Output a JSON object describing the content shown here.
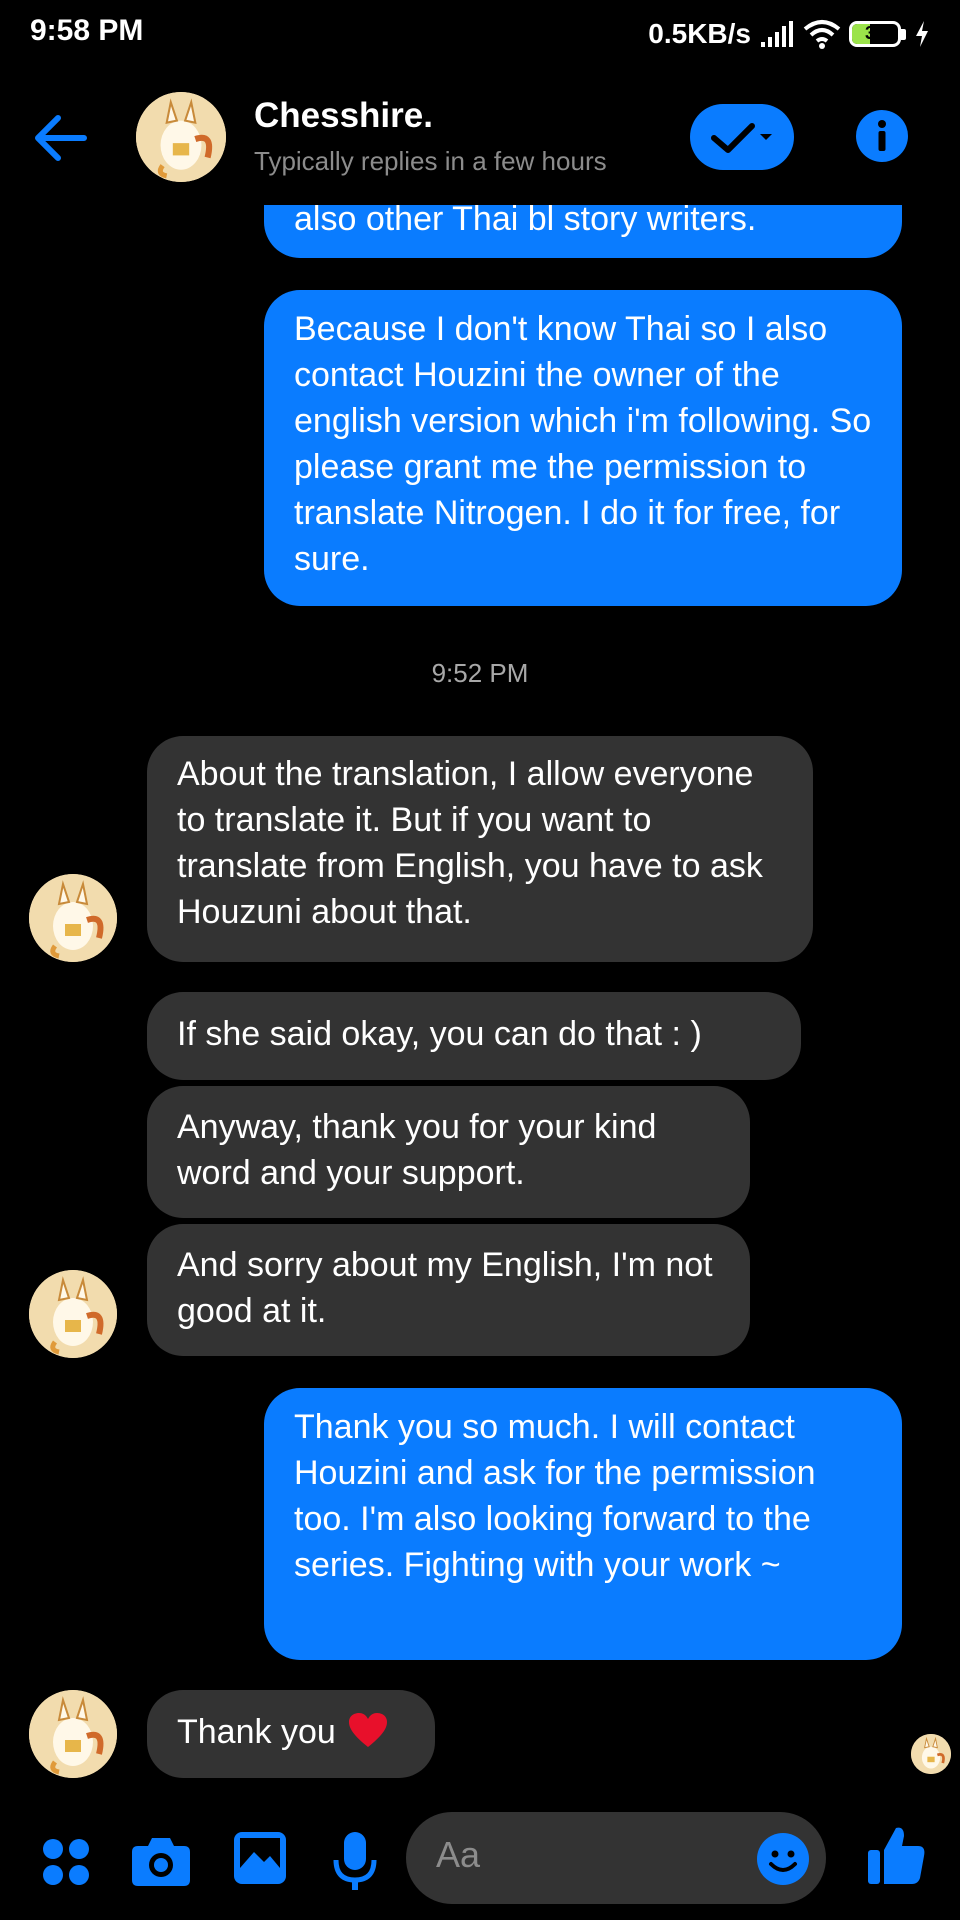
{
  "status_bar": {
    "time": "9:58 PM",
    "network_speed": "0.5KB/s",
    "battery": "39",
    "battery_level": 0.39,
    "icons": [
      "signal-icon",
      "wifi-icon",
      "battery-icon",
      "charging-icon"
    ]
  },
  "header": {
    "contact_name": "Chesshire.",
    "subtitle": "Typically replies in a few hours",
    "icons": [
      "back-arrow-icon",
      "checkmark-icon",
      "chevron-down-icon",
      "info-icon"
    ]
  },
  "messages": [
    {
      "from": "me",
      "text": "also other Thai bl story writers."
    },
    {
      "from": "me",
      "text": "Because I don't know Thai so I also contact Houzini the owner of the english version which i'm following. So please grant me the permission to translate Nitrogen. I do it for free, for sure."
    },
    {
      "from": "them",
      "text": "About the translation, I allow everyone to translate it. But if you want to translate from English, you have to ask Houzuni about that."
    },
    {
      "from": "them",
      "text": "If she said okay, you can do that : )"
    },
    {
      "from": "them",
      "text": "Anyway, thank you for your kind word and your support."
    },
    {
      "from": "them",
      "text": "And sorry about my English, I'm not good at it."
    },
    {
      "from": "me",
      "text": "Thank you so much. I will contact Houzini and ask for the permission too. I'm also looking forward to the series. Fighting with your work ~"
    },
    {
      "from": "them",
      "text": "Thank you",
      "emoji": "heart-emoji"
    }
  ],
  "timestamp": "9:52 PM",
  "composer": {
    "placeholder": "Aa",
    "icons": [
      "apps-icon",
      "camera-icon",
      "gallery-icon",
      "microphone-icon",
      "emoji-icon",
      "thumbs-up-icon"
    ]
  },
  "colors": {
    "accent": "#0a7cff",
    "incoming_bubble": "#333333",
    "background": "#000000"
  }
}
